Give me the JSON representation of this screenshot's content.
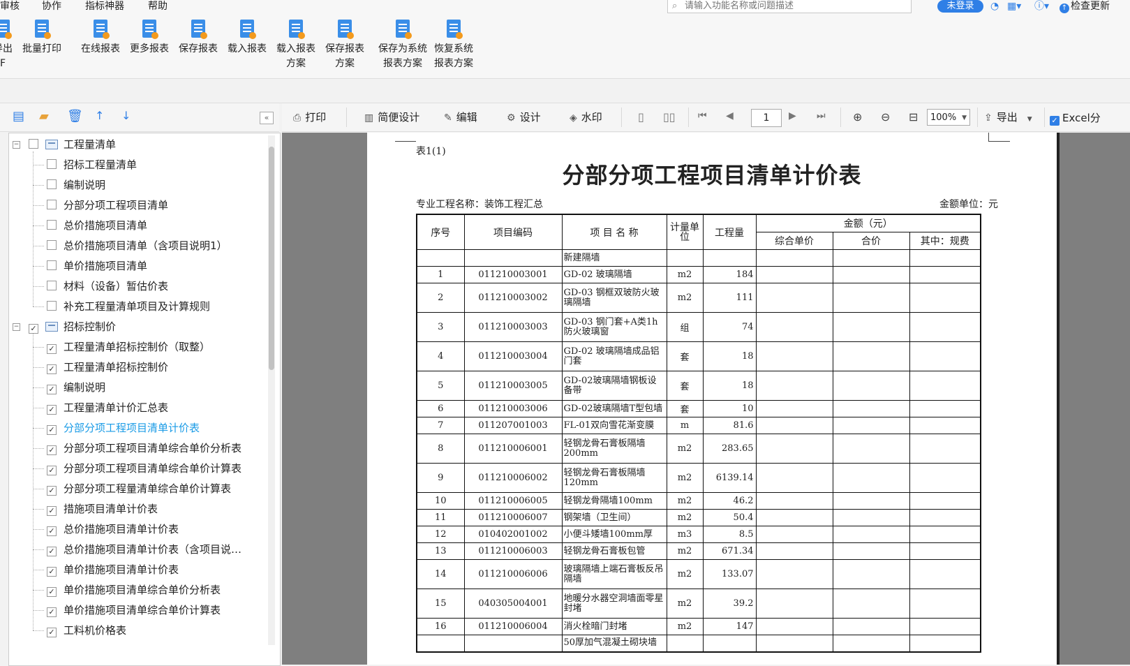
{
  "menu": [
    "审核",
    "协作",
    "指标神器",
    "帮助"
  ],
  "search": {
    "placeholder": "请输入功能名称或问题描述"
  },
  "login_label": "未登录",
  "update_label": "检查更新",
  "ribbon": [
    {
      "label1": "导出",
      "label2": "F"
    },
    {
      "label1": "批量打印",
      "label2": ""
    },
    {
      "label1": "在线报表",
      "label2": ""
    },
    {
      "label1": "更多报表",
      "label2": ""
    },
    {
      "label1": "保存报表",
      "label2": ""
    },
    {
      "label1": "载入报表",
      "label2": ""
    },
    {
      "label1": "载入报表",
      "label2": "方案"
    },
    {
      "label1": "保存报表",
      "label2": "方案"
    },
    {
      "label1": "保存为系统",
      "label2": "报表方案"
    },
    {
      "label1": "恢复系统",
      "label2": "报表方案"
    }
  ],
  "tree": [
    {
      "label": "工程量清单",
      "level": 0,
      "checked": false,
      "folder": true
    },
    {
      "label": "招标工程量清单",
      "level": 1,
      "checked": false
    },
    {
      "label": "编制说明",
      "level": 1,
      "checked": false
    },
    {
      "label": "分部分项工程项目清单",
      "level": 1,
      "checked": false
    },
    {
      "label": "总价措施项目清单",
      "level": 1,
      "checked": false
    },
    {
      "label": "总价措施项目清单（含项目说明1）",
      "level": 1,
      "checked": false
    },
    {
      "label": "单价措施项目清单",
      "level": 1,
      "checked": false
    },
    {
      "label": "材料（设备）暂估价表",
      "level": 1,
      "checked": false
    },
    {
      "label": "补充工程量清单项目及计算规则",
      "level": 1,
      "checked": false
    },
    {
      "label": "招标控制价",
      "level": 0,
      "checked": true,
      "folder": true
    },
    {
      "label": "工程量清单招标控制价（取整）",
      "level": 1,
      "checked": true
    },
    {
      "label": "工程量清单招标控制价",
      "level": 1,
      "checked": true
    },
    {
      "label": "编制说明",
      "level": 1,
      "checked": true
    },
    {
      "label": "工程量清单计价汇总表",
      "level": 1,
      "checked": true
    },
    {
      "label": "分部分项工程项目清单计价表",
      "level": 1,
      "checked": true,
      "selected": true
    },
    {
      "label": "分部分项工程项目清单综合单价分析表",
      "level": 1,
      "checked": true
    },
    {
      "label": "分部分项工程项目清单综合单价计算表",
      "level": 1,
      "checked": true
    },
    {
      "label": "分部分项工程量清单综合单价计算表",
      "level": 1,
      "checked": true
    },
    {
      "label": "措施项目清单计价表",
      "level": 1,
      "checked": true
    },
    {
      "label": "总价措施项目清单计价表",
      "level": 1,
      "checked": true
    },
    {
      "label": "总价措施项目清单计价表（含项目说…",
      "level": 1,
      "checked": true
    },
    {
      "label": "单价措施项目清单计价表",
      "level": 1,
      "checked": true
    },
    {
      "label": "单价措施项目清单综合单价分析表",
      "level": 1,
      "checked": true
    },
    {
      "label": "单价措施项目清单综合单价计算表",
      "level": 1,
      "checked": true
    },
    {
      "label": "工料机价格表",
      "level": 1,
      "checked": true
    }
  ],
  "toolbar": {
    "print": "打印",
    "simple_design": "简便设计",
    "edit": "编辑",
    "design": "设计",
    "watermark": "水印",
    "page": "1",
    "zoom": "100%",
    "export": "导出",
    "excel": "Excel分"
  },
  "report": {
    "sheet_no": "表1(1)",
    "title": "分部分项工程项目清单计价表",
    "project_name": "专业工程名称：装饰工程汇总",
    "unit": "金额单位：元",
    "headers": {
      "seq": "序号",
      "code": "项目编码",
      "name": "项 目 名 称",
      "uom": "计量单位",
      "qty": "工程量",
      "amount": "金额（元）",
      "unit_price": "综合单价",
      "total": "合价",
      "fee": "其中：规费"
    },
    "section": "新建隔墙",
    "rows": [
      {
        "seq": "1",
        "code": "011210003001",
        "name": "GD-02 玻璃隔墙",
        "uom": "m2",
        "qty": "184",
        "h": 24
      },
      {
        "seq": "2",
        "code": "011210003002",
        "name": "GD-03 钢框双玻防火玻璃隔墙",
        "uom": "m2",
        "qty": "111",
        "h": 42
      },
      {
        "seq": "3",
        "code": "011210003003",
        "name": "GD-03 钢门套+A类1h防火玻璃窗",
        "uom": "组",
        "qty": "74",
        "h": 42
      },
      {
        "seq": "4",
        "code": "011210003004",
        "name": "GD-02 玻璃隔墙成品铝门套",
        "uom": "套",
        "qty": "18",
        "h": 42
      },
      {
        "seq": "5",
        "code": "011210003005",
        "name": "GD-02玻璃隔墙钢板设备带",
        "uom": "套",
        "qty": "18",
        "h": 42
      },
      {
        "seq": "6",
        "code": "011210003006",
        "name": "GD-02玻璃隔墙T型包墙",
        "uom": "套",
        "qty": "10",
        "h": 24
      },
      {
        "seq": "7",
        "code": "011207001003",
        "name": "FL-01双向雪花渐变膜",
        "uom": "m",
        "qty": "81.6",
        "h": 24
      },
      {
        "seq": "8",
        "code": "011210006001",
        "name": "轻钢龙骨石膏板隔墙200mm",
        "uom": "m2",
        "qty": "283.65",
        "h": 42
      },
      {
        "seq": "9",
        "code": "011210006002",
        "name": "轻钢龙骨石膏板隔墙120mm",
        "uom": "m2",
        "qty": "6139.14",
        "h": 42
      },
      {
        "seq": "10",
        "code": "011210006005",
        "name": "轻钢龙骨隔墙100mm",
        "uom": "m2",
        "qty": "46.2",
        "h": 24
      },
      {
        "seq": "11",
        "code": "011210006007",
        "name": "钢架墙（卫生间）",
        "uom": "m2",
        "qty": "50.4",
        "h": 24
      },
      {
        "seq": "12",
        "code": "010402001002",
        "name": "小便斗矮墙100mm厚",
        "uom": "m3",
        "qty": "8.5",
        "h": 24
      },
      {
        "seq": "13",
        "code": "011210006003",
        "name": "轻钢龙骨石膏板包管",
        "uom": "m2",
        "qty": "671.34",
        "h": 24
      },
      {
        "seq": "14",
        "code": "011210006006",
        "name": "玻璃隔墙上端石膏板反吊隔墙",
        "uom": "m2",
        "qty": "133.07",
        "h": 42
      },
      {
        "seq": "15",
        "code": "040305004001",
        "name": "地暖分水器空洞墙面零星封堵",
        "uom": "m2",
        "qty": "39.2",
        "h": 42
      },
      {
        "seq": "16",
        "code": "011210006004",
        "name": "消火栓暗门封堵",
        "uom": "m2",
        "qty": "147",
        "h": 24
      },
      {
        "seq": "",
        "code": "",
        "name": "50厚加气混凝土砌块墙",
        "uom": "",
        "qty": "",
        "h": 24
      }
    ]
  },
  "colors": {
    "accent": "#2f7fe6",
    "selected_text": "#1a9be6",
    "preview_bg": "#7f7f7f"
  }
}
